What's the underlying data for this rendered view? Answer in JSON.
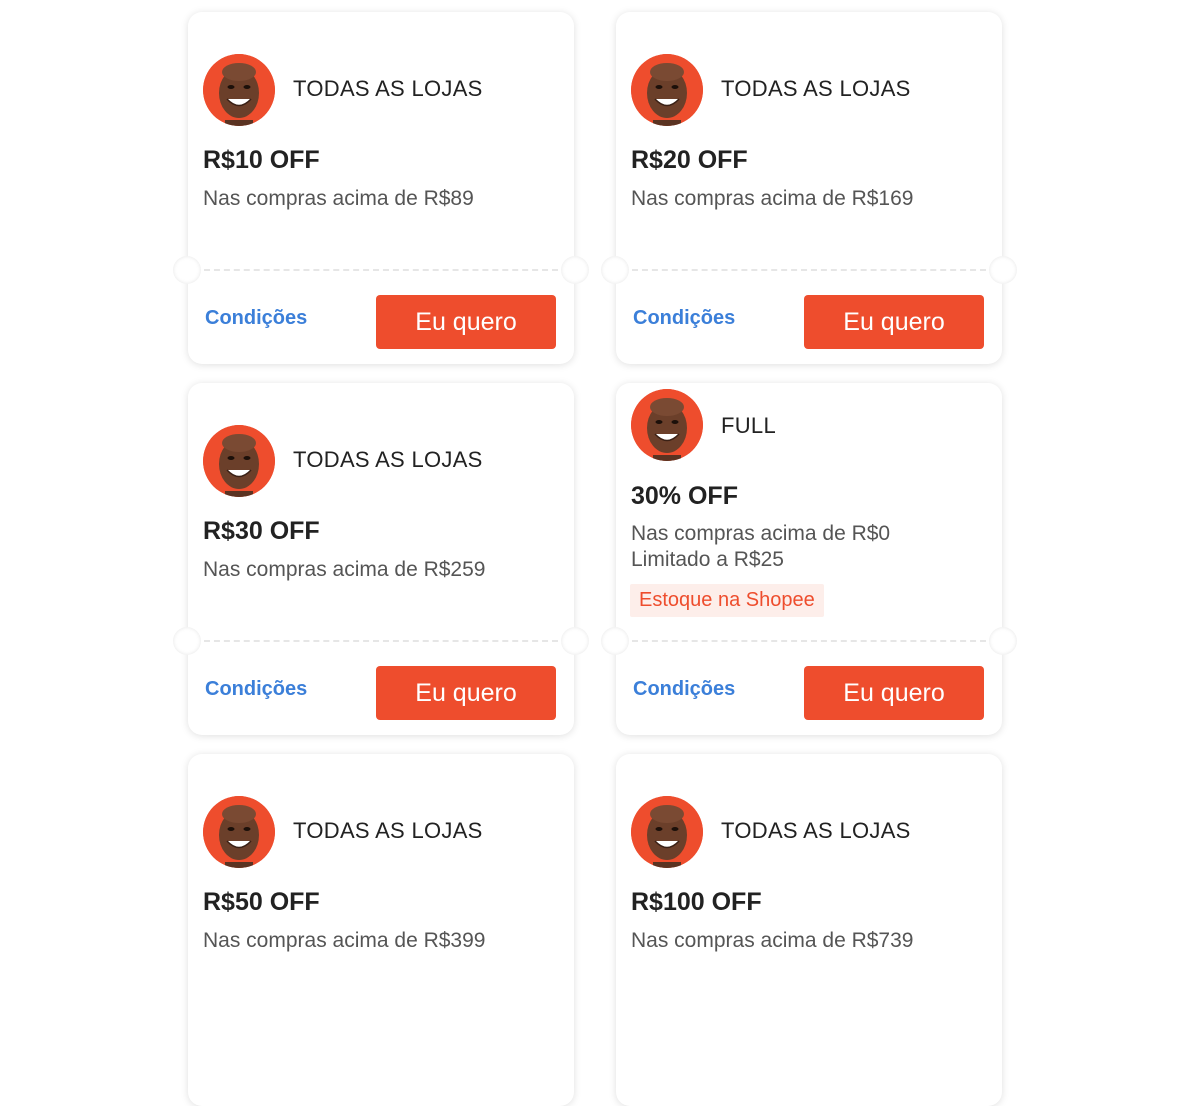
{
  "coupons": [
    {
      "store": "TODAS AS LOJAS",
      "discount": "R$10 OFF",
      "minimum": "Nas compras acima de R$89",
      "conditions": "Condições",
      "button": "Eu quero"
    },
    {
      "store": "TODAS AS LOJAS",
      "discount": "R$20 OFF",
      "minimum": "Nas compras acima de R$169",
      "conditions": "Condições",
      "button": "Eu quero"
    },
    {
      "store": "TODAS AS LOJAS",
      "discount": "R$30 OFF",
      "minimum": "Nas compras acima de R$259",
      "conditions": "Condições",
      "button": "Eu quero"
    },
    {
      "store": "FULL",
      "discount": "30% OFF",
      "minimum": "Nas compras acima de R$0",
      "limit": "Limitado a R$25",
      "tag": "Estoque na Shopee",
      "conditions": "Condições",
      "button": "Eu quero"
    },
    {
      "store": "TODAS AS LOJAS",
      "discount": "R$50 OFF",
      "minimum": "Nas compras acima de R$399"
    },
    {
      "store": "TODAS AS LOJAS",
      "discount": "R$100 OFF",
      "minimum": "Nas compras acima de R$739"
    }
  ],
  "colors": {
    "accent": "#ee4d2d",
    "link": "#3b7fd9",
    "tag_bg": "#fdeeea"
  },
  "icons": {
    "avatar": "store-avatar-icon"
  }
}
